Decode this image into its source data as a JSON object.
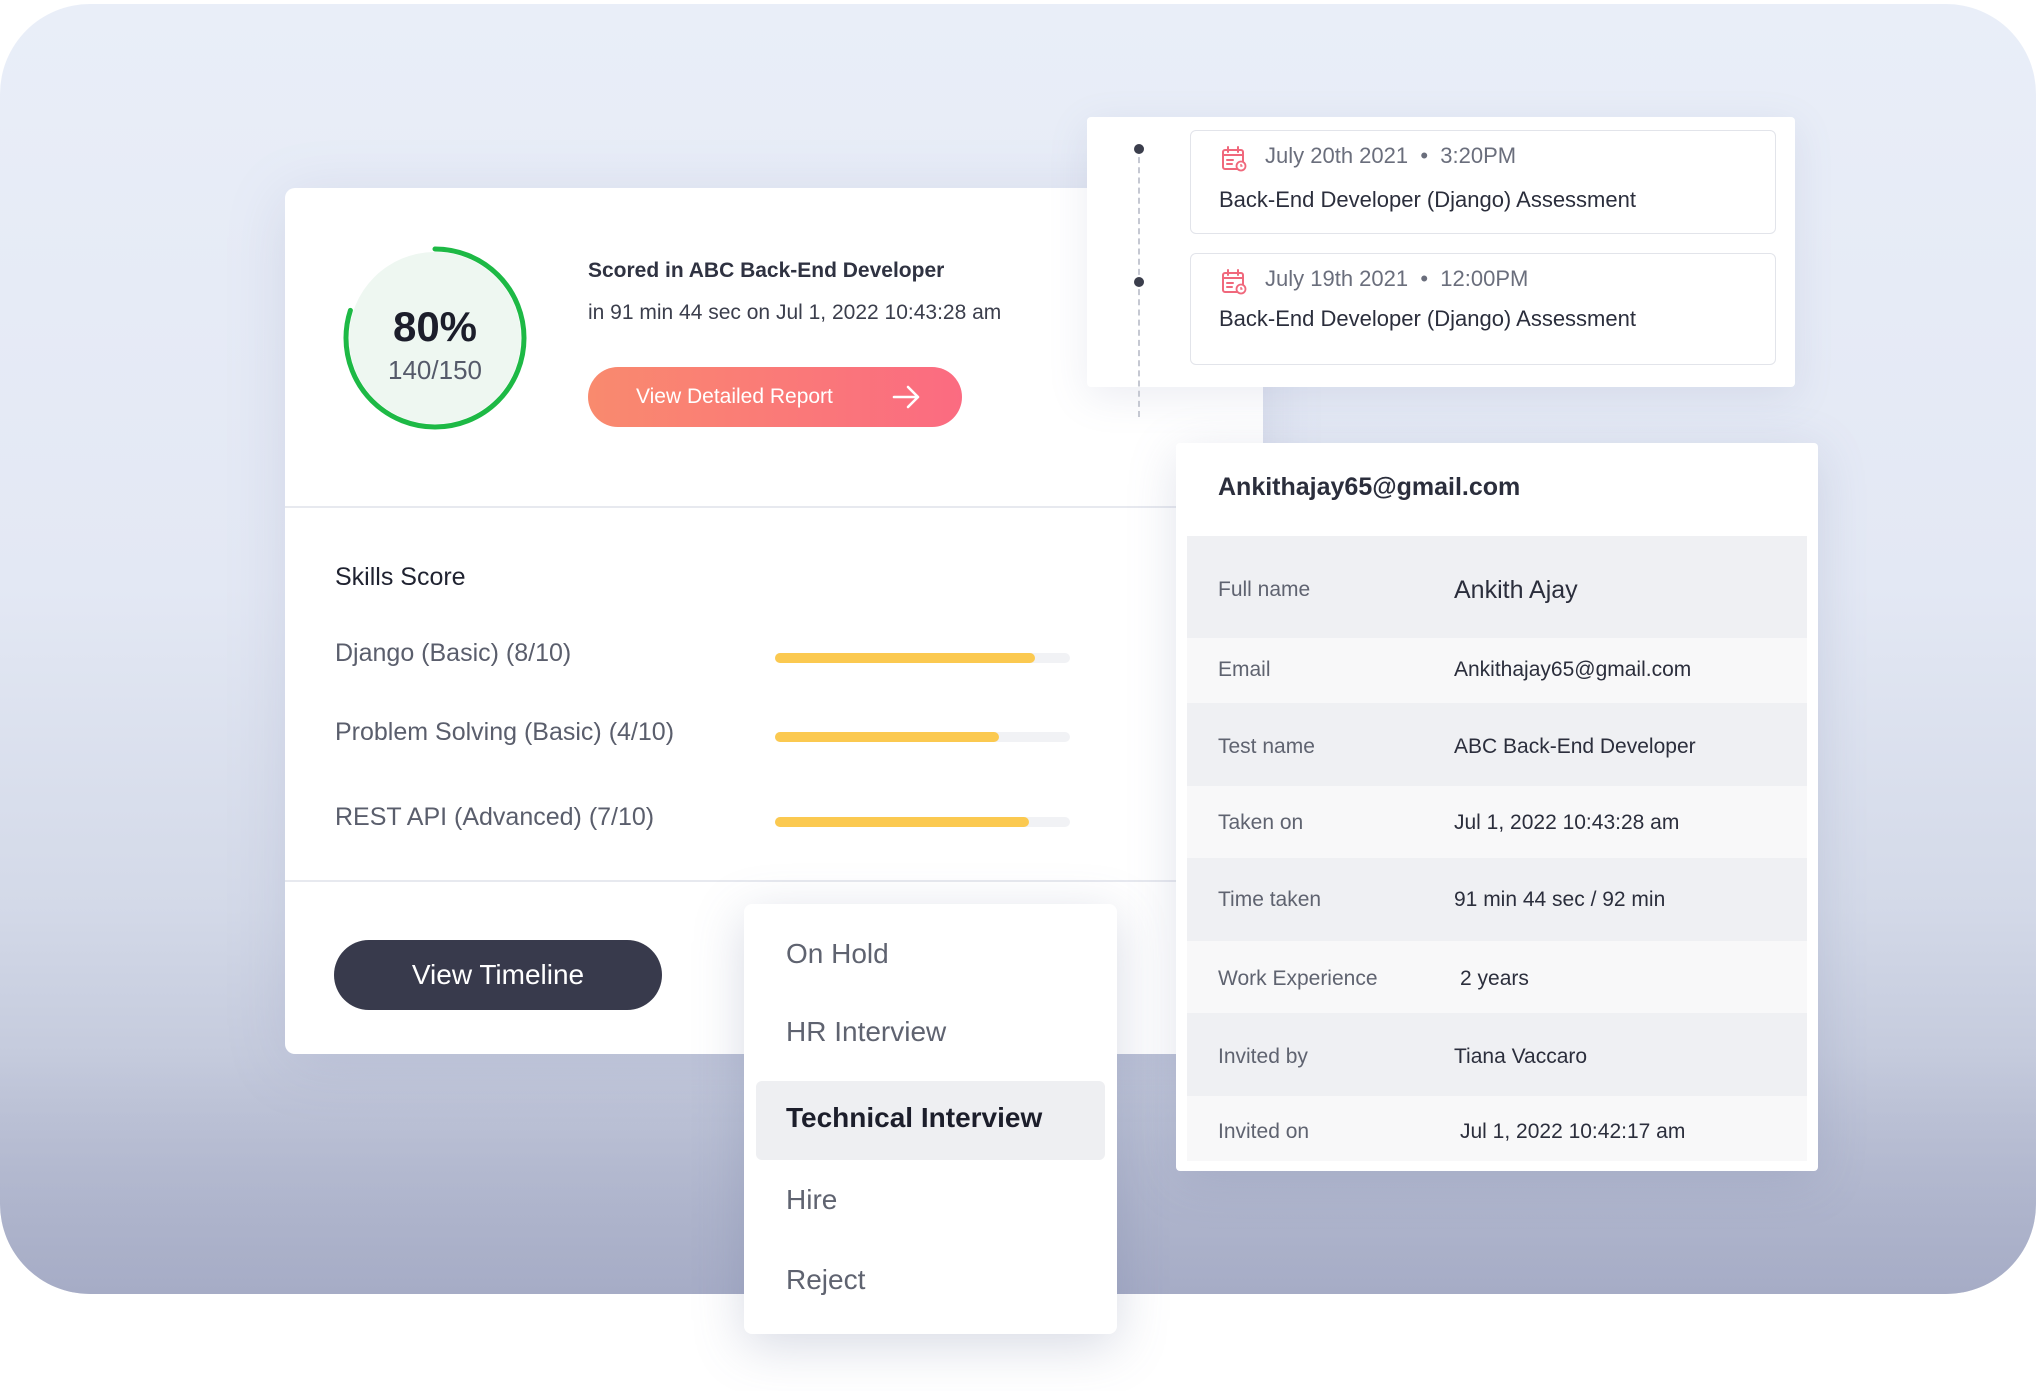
{
  "score": {
    "percent_label": "80%",
    "fraction_label": "140/150",
    "progress": 0.8,
    "title": "Scored in ABC Back-End Developer",
    "subtitle": "in 91 min 44 sec on Jul 1, 2022 10:43:28 am",
    "report_button": "View Detailed Report"
  },
  "skills": {
    "title": "Skills Score",
    "items": [
      {
        "label": "Django (Basic) (8/10)",
        "fraction": 0.88
      },
      {
        "label": "Problem Solving (Basic) (4/10)",
        "fraction": 0.76
      },
      {
        "label": "REST API (Advanced) (7/10)",
        "fraction": 0.86
      }
    ]
  },
  "timeline_button": "View Timeline",
  "timeline": [
    {
      "date": "July 20th 2021",
      "time": "3:20PM",
      "title": "Back-End Developer (Django) Assessment"
    },
    {
      "date": "July 19th 2021",
      "time": "12:00PM",
      "title": "Back-End Developer (Django) Assessment"
    }
  ],
  "profile": {
    "email_header": "Ankithajay65@gmail.com",
    "rows": [
      {
        "key": "Full name",
        "value": "Ankith Ajay"
      },
      {
        "key": "Email",
        "value": "Ankithajay65@gmail.com"
      },
      {
        "key": "Test name",
        "value": "ABC Back-End Developer"
      },
      {
        "key": "Taken on",
        "value": "Jul 1, 2022 10:43:28 am"
      },
      {
        "key": "Time taken",
        "value": "91 min 44 sec / 92 min"
      },
      {
        "key": "Work Experience",
        "value": "2 years"
      },
      {
        "key": "Invited by",
        "value": "Tiana Vaccaro"
      },
      {
        "key": "Invited on",
        "value": "Jul 1, 2022 10:42:17 am"
      }
    ]
  },
  "status_menu": {
    "options": [
      "On Hold",
      "HR Interview",
      "Technical Interview",
      "Hire",
      "Reject"
    ],
    "selected": "Technical Interview"
  },
  "colors": {
    "ring": "#1db945",
    "ring_bg": "#eef7f1",
    "skill_bar": "#fbc950",
    "report_button_start": "#f98a6e",
    "report_button_end": "#fb6b81",
    "timeline_button": "#383a4c",
    "calendar_icon": "#f0687c"
  }
}
